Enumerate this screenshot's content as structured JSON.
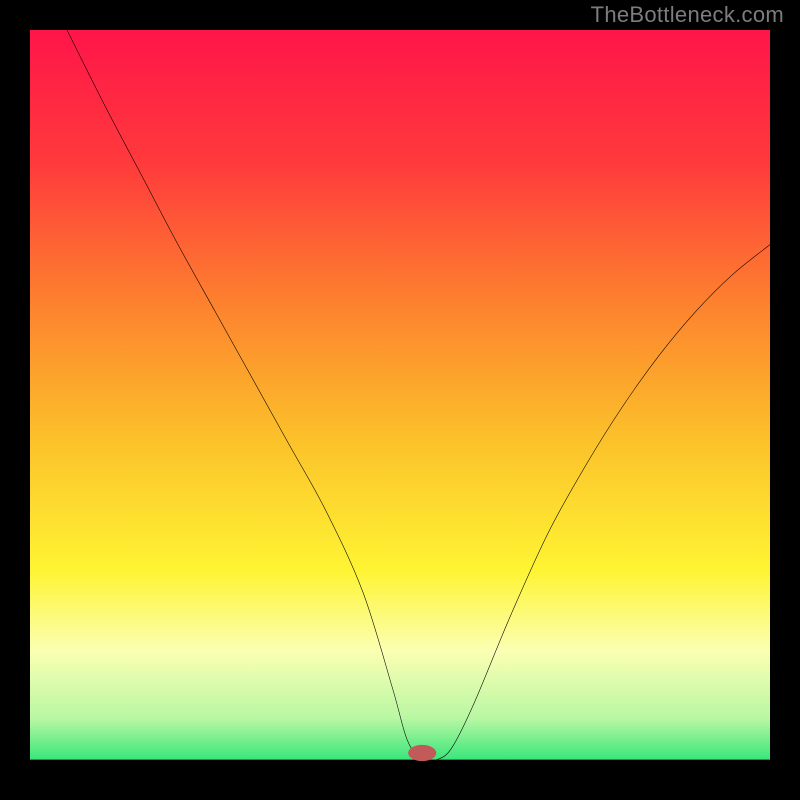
{
  "credit": "TheBottleneck.com",
  "chart_data": {
    "type": "line",
    "title": "",
    "xlabel": "",
    "ylabel": "",
    "xlim": [
      0,
      100
    ],
    "ylim": [
      0,
      100
    ],
    "grid": false,
    "legend": false,
    "background_gradient": {
      "stops": [
        {
          "offset": 0.0,
          "color": "#ff1549"
        },
        {
          "offset": 0.18,
          "color": "#ff3a3c"
        },
        {
          "offset": 0.36,
          "color": "#fd7e2f"
        },
        {
          "offset": 0.55,
          "color": "#fcc02a"
        },
        {
          "offset": 0.73,
          "color": "#fef433"
        },
        {
          "offset": 0.84,
          "color": "#fbffb3"
        },
        {
          "offset": 0.93,
          "color": "#b9f7a3"
        },
        {
          "offset": 1.0,
          "color": "#19e271"
        }
      ]
    },
    "floor": {
      "y": 1.4,
      "color": "#000000"
    },
    "marker": {
      "x": 53,
      "y": 2.3,
      "rx": 1.9,
      "ry": 1.1,
      "color": "#c25a59"
    },
    "series": [
      {
        "name": "bottleneck-curve",
        "color": "#000000",
        "width": 3,
        "x": [
          5,
          10,
          15,
          20,
          25,
          30,
          35,
          40,
          45,
          49,
          51,
          53,
          55,
          57,
          60,
          65,
          70,
          75,
          80,
          85,
          90,
          95,
          100
        ],
        "y": [
          100,
          90,
          80.5,
          71,
          62,
          53,
          44,
          35,
          24,
          11,
          4,
          1.4,
          1.4,
          3,
          9,
          21,
          32,
          41,
          49,
          56,
          62,
          67,
          71
        ]
      }
    ]
  }
}
